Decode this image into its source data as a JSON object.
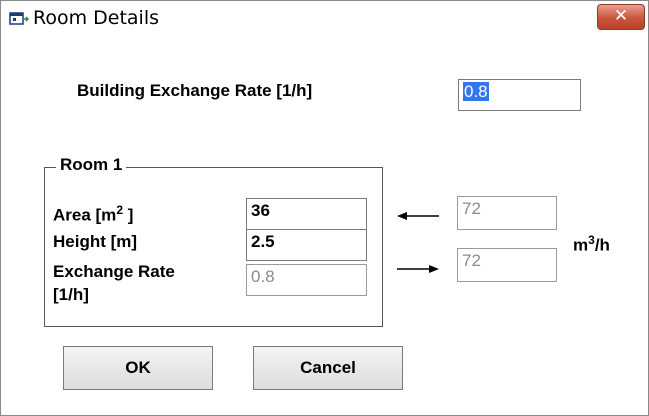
{
  "window": {
    "title": "Room Details"
  },
  "building": {
    "label": "Building Exchange Rate [1/h]",
    "value": "0.8"
  },
  "room": {
    "group_label": "Room 1",
    "area_label": "Area [m",
    "area_sup": "2",
    "area_label_end": " ]",
    "height_label": "Height [m]",
    "exchange_label_line1": "Exchange Rate",
    "exchange_label_line2": "[1/h]",
    "area_value": "36",
    "height_value": "2.5",
    "exchange_value": "0.8"
  },
  "flow": {
    "in_value": "72",
    "out_value": "72",
    "unit_m": "m",
    "unit_sup": "3",
    "unit_end": "/h"
  },
  "buttons": {
    "ok": "OK",
    "cancel": "Cancel"
  },
  "icons": {
    "app": "window-app-icon",
    "close": "close-icon"
  }
}
